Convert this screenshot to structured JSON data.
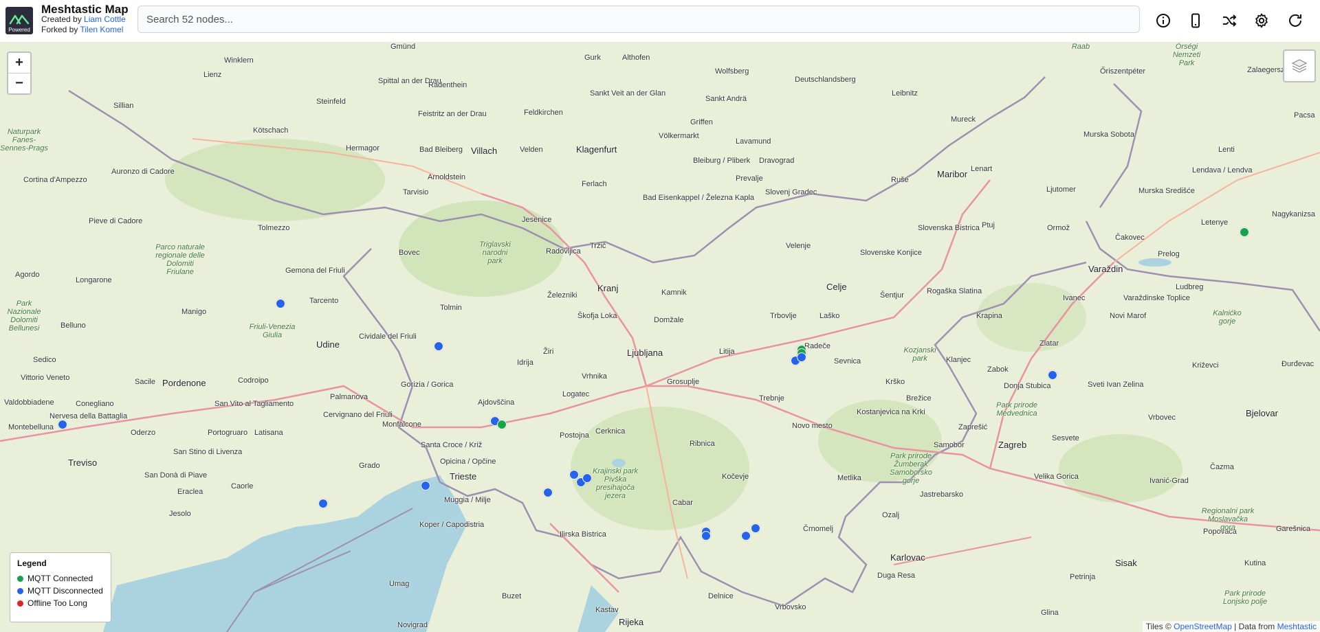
{
  "header": {
    "title": "Meshtastic Map",
    "created_by_prefix": "Created by ",
    "created_by_name": "Liam Cottle",
    "forked_by_prefix": "Forked by ",
    "forked_by_name": "Tilen Komel",
    "logo_badge": "Powered",
    "search_placeholder": "Search 52 nodes...",
    "buttons": [
      "info-icon",
      "phone-icon",
      "shuffle-icon",
      "gear-icon",
      "refresh-icon"
    ]
  },
  "map": {
    "zoom_in": "+",
    "zoom_out": "−",
    "legend": {
      "title": "Legend",
      "items": [
        {
          "label": "MQTT Connected",
          "color": "#16a34a"
        },
        {
          "label": "MQTT Disconnected",
          "color": "#2563eb"
        },
        {
          "label": "Offline Too Long",
          "color": "#dc2626"
        }
      ]
    },
    "attribution": {
      "prefix": "Tiles © ",
      "tiles_link": "OpenStreetMap",
      "middle": " | Data from ",
      "data_link": "Meshtastic"
    },
    "places": [
      {
        "name": "Gmünd"
      },
      {
        "name": "Gurk"
      },
      {
        "name": "Althofen"
      },
      {
        "name": "Wolfsberg"
      },
      {
        "name": "Deutschlandsberg"
      },
      {
        "name": "Leibnitz"
      },
      {
        "name": "Winklern"
      },
      {
        "name": "Lienz"
      },
      {
        "name": "Spittal an der Drau"
      },
      {
        "name": "Radenthein"
      },
      {
        "name": "Sankt Veit an der Glan"
      },
      {
        "name": "Sankt Andrä"
      },
      {
        "name": "Sillian"
      },
      {
        "name": "Steinfeld"
      },
      {
        "name": "Feistritz an der Drau"
      },
      {
        "name": "Feldkirchen"
      },
      {
        "name": "Griffen"
      },
      {
        "name": "Kötschach"
      },
      {
        "name": "Völkermarkt"
      },
      {
        "name": "Lavamund"
      },
      {
        "name": "Hermagor"
      },
      {
        "name": "Bad Bleiberg"
      },
      {
        "name": "Villach"
      },
      {
        "name": "Velden"
      },
      {
        "name": "Klagenfurt"
      },
      {
        "name": "Bleiburg / Pliberk"
      },
      {
        "name": "Dravograd"
      },
      {
        "name": "Auronzo di Cadore"
      },
      {
        "name": "Cortina d'Ampezzo"
      },
      {
        "name": "Arnoldstein"
      },
      {
        "name": "Ferlach"
      },
      {
        "name": "Prevalje"
      },
      {
        "name": "Ruše"
      },
      {
        "name": "Maribor"
      },
      {
        "name": "Tarvisio"
      },
      {
        "name": "Bad Eisenkappel / Železna Kapla"
      },
      {
        "name": "Slovenj Gradec"
      },
      {
        "name": "Pieve di Cadore"
      },
      {
        "name": "Jesenice"
      },
      {
        "name": "Tolmezzo"
      },
      {
        "name": "Radovljica"
      },
      {
        "name": "Tržič"
      },
      {
        "name": "Velenje"
      },
      {
        "name": "Slovenska Bistrica"
      },
      {
        "name": "Ptuj"
      },
      {
        "name": "Ormož"
      },
      {
        "name": "Lenart"
      },
      {
        "name": "Murska Sobota"
      },
      {
        "name": "Mureck"
      },
      {
        "name": "Ljutomer"
      },
      {
        "name": "Gemona del Friuli"
      },
      {
        "name": "Bovec"
      },
      {
        "name": "Slovenske Konjice"
      },
      {
        "name": "Agordo"
      },
      {
        "name": "Longarone"
      },
      {
        "name": "Tarcento"
      },
      {
        "name": "Železniki"
      },
      {
        "name": "Kranj"
      },
      {
        "name": "Kamnik"
      },
      {
        "name": "Celje"
      },
      {
        "name": "Šentjur"
      },
      {
        "name": "Rogaška Slatina"
      },
      {
        "name": "Manigo"
      },
      {
        "name": "Tolmin"
      },
      {
        "name": "Škofja Loka"
      },
      {
        "name": "Domžale"
      },
      {
        "name": "Trbovlje"
      },
      {
        "name": "Laško"
      },
      {
        "name": "Belluno"
      },
      {
        "name": "Cividale del Friuli"
      },
      {
        "name": "Udine"
      },
      {
        "name": "Ljubljana"
      },
      {
        "name": "Litija"
      },
      {
        "name": "Radeče"
      },
      {
        "name": "Sevnica"
      },
      {
        "name": "Sedico"
      },
      {
        "name": "Idrija"
      },
      {
        "name": "Žiri"
      },
      {
        "name": "Vittorio Veneto"
      },
      {
        "name": "Sacile"
      },
      {
        "name": "Pordenone"
      },
      {
        "name": "Codroipo"
      },
      {
        "name": "Vrhnika"
      },
      {
        "name": "Grosuplje"
      },
      {
        "name": "Krško"
      },
      {
        "name": "Gorizia / Gorica"
      },
      {
        "name": "San Vito al Tagliamento"
      },
      {
        "name": "Logatec"
      },
      {
        "name": "Trebnje"
      },
      {
        "name": "Brežice"
      },
      {
        "name": "Valdobbiadene"
      },
      {
        "name": "Conegliano"
      },
      {
        "name": "Palmanova"
      },
      {
        "name": "Ajdovščina"
      },
      {
        "name": "Kostanjevica na Krki"
      },
      {
        "name": "Nervesa della Battaglia"
      },
      {
        "name": "Cervignano del Friuli"
      },
      {
        "name": "Monfalcone"
      },
      {
        "name": "Novo mesto"
      },
      {
        "name": "Cerknica"
      },
      {
        "name": "Montebelluna"
      },
      {
        "name": "Oderzo"
      },
      {
        "name": "Portogruaro"
      },
      {
        "name": "Latisana"
      },
      {
        "name": "Santa Croce / Križ"
      },
      {
        "name": "Postojna"
      },
      {
        "name": "Ribnica"
      },
      {
        "name": "Treviso"
      },
      {
        "name": "San Stino di Livenza"
      },
      {
        "name": "Grado"
      },
      {
        "name": "Opicina / Opčine"
      },
      {
        "name": "Trieste"
      },
      {
        "name": "San Donà di Piave"
      },
      {
        "name": "Kočevje"
      },
      {
        "name": "Metlika"
      },
      {
        "name": "Caorle"
      },
      {
        "name": "Eraclea"
      },
      {
        "name": "Muggia / Milje"
      },
      {
        "name": "Ilirska Bistrica"
      },
      {
        "name": "Cabar"
      },
      {
        "name": "Črnomelj"
      },
      {
        "name": "Jesolo"
      },
      {
        "name": "Koper / Capodistria"
      },
      {
        "name": "Karlovac"
      },
      {
        "name": "Duga Resa"
      },
      {
        "name": "Umag"
      },
      {
        "name": "Buzet"
      },
      {
        "name": "Delnice"
      },
      {
        "name": "Vrbovsko"
      },
      {
        "name": "Kastav"
      },
      {
        "name": "Rijeka"
      },
      {
        "name": "Novigrad"
      },
      {
        "name": "Zalaegerszeg"
      },
      {
        "name": "Lendava / Lendva"
      },
      {
        "name": "Čakovec"
      },
      {
        "name": "Varaždin"
      },
      {
        "name": "Ludbreg"
      },
      {
        "name": "Ivanec"
      },
      {
        "name": "Krapina"
      },
      {
        "name": "Zlatar"
      },
      {
        "name": "Zabok"
      },
      {
        "name": "Donja Stubica"
      },
      {
        "name": "Zaprešić"
      },
      {
        "name": "Zagreb"
      },
      {
        "name": "Samobor"
      },
      {
        "name": "Sesvete"
      },
      {
        "name": "Velika Gorica"
      },
      {
        "name": "Jastrebarsko"
      },
      {
        "name": "Ozalj"
      },
      {
        "name": "Bjelovar"
      },
      {
        "name": "Križevci"
      },
      {
        "name": "Vrbovec"
      },
      {
        "name": "Sisak"
      },
      {
        "name": "Petrinja"
      },
      {
        "name": "Glina"
      },
      {
        "name": "Kutina"
      },
      {
        "name": "Popovača"
      },
      {
        "name": "Ivanić-Grad"
      },
      {
        "name": "Čazma"
      },
      {
        "name": "Novi Marof"
      },
      {
        "name": "Klanjec"
      },
      {
        "name": "Prelog"
      },
      {
        "name": "Nagykanizsa"
      },
      {
        "name": "Letenye"
      },
      {
        "name": "Murska Središće"
      },
      {
        "name": "Lenti"
      },
      {
        "name": "Pacsa"
      },
      {
        "name": "Őriszentpéter"
      },
      {
        "name": "Varaždinske Toplice"
      },
      {
        "name": "Sveti Ivan Zelina"
      },
      {
        "name": "Garešnica"
      },
      {
        "name": "Đurđevac"
      }
    ],
    "parks": [
      {
        "name": "Triglavski narodni park"
      },
      {
        "name": "Friuli-Venezia Giulia"
      },
      {
        "name": "Parco naturale regionale delle Dolomiti Friulane"
      },
      {
        "name": "Krajinski park Pivška presihajoča jezera"
      },
      {
        "name": "Kozjanski park"
      },
      {
        "name": "Park prirode Medvednica"
      },
      {
        "name": "Park prirode Žumberak Samoborsko gorje"
      },
      {
        "name": "Regionalni park Moslavačka gora"
      },
      {
        "name": "Őrségi Nemzeti Park"
      },
      {
        "name": "Kalnićko gorje"
      },
      {
        "name": "Park Nazionale Dolomiti Bellunesi"
      },
      {
        "name": "Naturpark Fanes-Sennes-Prags"
      },
      {
        "name": "Park prirode Lonjsko polje"
      },
      {
        "name": "Raab"
      }
    ],
    "nodes": [
      {
        "status": "disconnected",
        "lat": 46.22,
        "lon": 12.95
      },
      {
        "status": "disconnected",
        "lat": 46.1,
        "lon": 13.43
      },
      {
        "status": "disconnected",
        "lat": 45.88,
        "lon": 12.29
      },
      {
        "status": "disconnected",
        "lat": 45.89,
        "lon": 13.6
      },
      {
        "status": "connected",
        "lat": 45.88,
        "lon": 13.62
      },
      {
        "status": "disconnected",
        "lat": 45.71,
        "lon": 13.39
      },
      {
        "status": "disconnected",
        "lat": 45.66,
        "lon": 13.08
      },
      {
        "status": "disconnected",
        "lat": 45.69,
        "lon": 13.76
      },
      {
        "status": "disconnected",
        "lat": 45.74,
        "lon": 13.84
      },
      {
        "status": "disconnected",
        "lat": 45.72,
        "lon": 13.86
      },
      {
        "status": "disconnected",
        "lat": 45.73,
        "lon": 13.88
      },
      {
        "status": "connected",
        "lat": 46.09,
        "lon": 14.53
      },
      {
        "status": "connected",
        "lat": 46.08,
        "lon": 14.53
      },
      {
        "status": "disconnected",
        "lat": 46.06,
        "lon": 14.51
      },
      {
        "status": "disconnected",
        "lat": 46.07,
        "lon": 14.53
      },
      {
        "status": "disconnected",
        "lat": 46.02,
        "lon": 15.29
      },
      {
        "status": "connected",
        "lat": 46.42,
        "lon": 15.87
      },
      {
        "status": "disconnected",
        "lat": 45.58,
        "lon": 14.24
      },
      {
        "status": "disconnected",
        "lat": 45.57,
        "lon": 14.24
      },
      {
        "status": "disconnected",
        "lat": 45.57,
        "lon": 14.36
      },
      {
        "status": "disconnected",
        "lat": 45.59,
        "lon": 14.39
      }
    ]
  }
}
